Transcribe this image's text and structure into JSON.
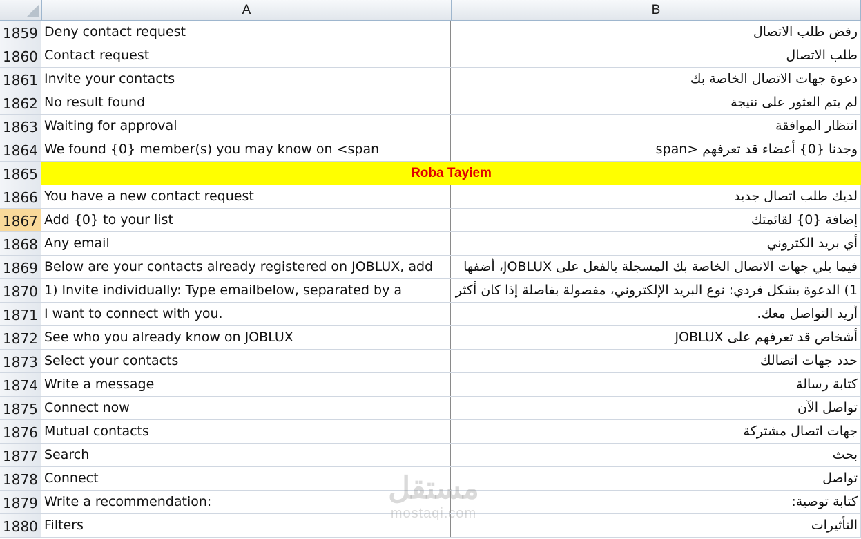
{
  "sheet": {
    "column_headers": [
      "A",
      "B"
    ],
    "selected_row": "1867",
    "highlight_row": {
      "row": "1865",
      "text": "Roba Tayiem",
      "background": "#ffff00",
      "color": "#e00000"
    },
    "rows": [
      {
        "num": "1859",
        "a": "Deny contact request",
        "b": "رفض طلب الاتصال"
      },
      {
        "num": "1860",
        "a": "Contact request",
        "b": "طلب الاتصال"
      },
      {
        "num": "1861",
        "a": "Invite your contacts",
        "b": "دعوة جهات الاتصال الخاصة بك"
      },
      {
        "num": "1862",
        "a": "No result found",
        "b": "لم يتم العثور على نتيجة"
      },
      {
        "num": "1863",
        "a": "Waiting for approval",
        "b": "انتظار الموافقة"
      },
      {
        "num": "1864",
        "a": "We found {0} member(s) you may know on <span",
        "b": "وجدنا {0} أعضاء قد تعرفهم <span"
      },
      {
        "num": "1865",
        "merged": true
      },
      {
        "num": "1866",
        "a": "You have a new contact request",
        "b": "لديك طلب اتصال جديد"
      },
      {
        "num": "1867",
        "a": "Add {0} to your list",
        "b": "إضافة {0} لقائمتك"
      },
      {
        "num": "1868",
        "a": "Any email",
        "b": "أي بريد الكتروني"
      },
      {
        "num": "1869",
        "a": "Below are your contacts already registered on JOBLUX, add",
        "b": "فيما يلي جهات الاتصال الخاصة بك المسجلة بالفعل على JOBLUX، أضفها"
      },
      {
        "num": "1870",
        "a": "1) Invite individually: Type emailbelow, separated by a",
        "b": "1) الدعوة بشكل فردي: نوع البريد الإلكتروني، مفصولة بفاصلة إذا كان أكثر"
      },
      {
        "num": "1871",
        "a": "I want to connect with you.",
        "b": "أريد التواصل معك."
      },
      {
        "num": "1872",
        "a": "See who you already know on JOBLUX",
        "b": "أشخاص قد تعرفهم على JOBLUX"
      },
      {
        "num": "1873",
        "a": "Select your contacts",
        "b": "حدد جهات اتصالك"
      },
      {
        "num": "1874",
        "a": "Write a message",
        "b": "كتابة رسالة"
      },
      {
        "num": "1875",
        "a": "Connect now",
        "b": "تواصل الآن"
      },
      {
        "num": "1876",
        "a": "Mutual contacts",
        "b": "جهات اتصال مشتركة"
      },
      {
        "num": "1877",
        "a": "Search",
        "b": "بحث"
      },
      {
        "num": "1878",
        "a": "Connect",
        "b": "تواصل"
      },
      {
        "num": "1879",
        "a": "Write a recommendation:",
        "b": "كتابة توصية:"
      },
      {
        "num": "1880",
        "a": "Filters",
        "b": "التأثيرات"
      }
    ]
  },
  "watermark": {
    "main": "مستقل",
    "sub": "mostaqi.com"
  }
}
